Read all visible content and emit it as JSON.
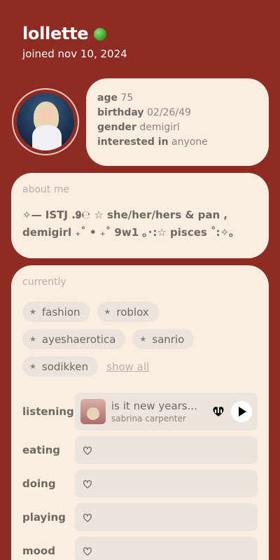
{
  "profile": {
    "name": "lollette",
    "joined": "joined nov 10, 2024"
  },
  "stats": [
    {
      "label": "age",
      "value": "75"
    },
    {
      "label": "birthday",
      "value": "02/26/49"
    },
    {
      "label": "gender",
      "value": "demigirl"
    },
    {
      "label": "interested in",
      "value": "anyone"
    }
  ],
  "about": {
    "title": "about me",
    "line1": "✧— ISTJ .𝟗℮ ☆ she/her/hers & pan ,",
    "line2": "demigirl ₊˚ • ₊˚ 9w1 ｡･:☆ pisces ˚:✧｡"
  },
  "currently": {
    "title": "currently",
    "chips": [
      "fashion",
      "roblox",
      "ayeshaerotica",
      "sanrio",
      "sodikken"
    ],
    "show_all": "show all",
    "listening": {
      "label": "listening",
      "title": "is it new years...",
      "artist": "sabrina carpenter"
    },
    "rows": [
      "eating",
      "doing",
      "playing",
      "mood"
    ]
  },
  "colors": {
    "background": "#8e2b23",
    "card": "#fbeee0",
    "status": "#3fa62f"
  }
}
